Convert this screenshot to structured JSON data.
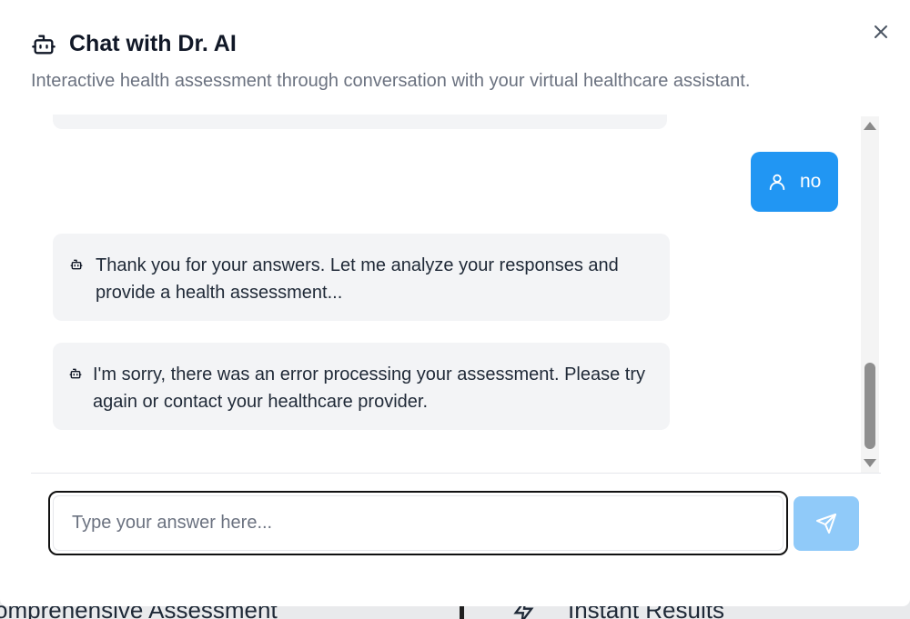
{
  "modal": {
    "title": "Chat with Dr. AI",
    "subtitle": "Interactive health assessment through conversation with your virtual healthcare assistant.",
    "close_icon": "close-icon",
    "title_icon": "bot-icon"
  },
  "messages": [
    {
      "role": "user",
      "text": "no",
      "icon": "user-icon"
    },
    {
      "role": "assistant",
      "text": "Thank you for your answers. Let me analyze your responses and provide a health assessment...",
      "icon": "bot-icon"
    },
    {
      "role": "assistant",
      "text": "I'm sorry, there was an error processing your assessment. Please try again or contact your healthcare provider.",
      "icon": "bot-icon"
    }
  ],
  "input": {
    "value": "",
    "placeholder": "Type your answer here..."
  },
  "send_button": {
    "icon": "send-icon"
  },
  "background_page": {
    "card1_title": "omprehensive Assessment",
    "card2_title": "Instant Results",
    "card2_icon": "zap-icon"
  },
  "colors": {
    "user_bubble": "#2196f3",
    "assistant_bubble": "#f3f4f6",
    "send_button": "#90caf9"
  }
}
